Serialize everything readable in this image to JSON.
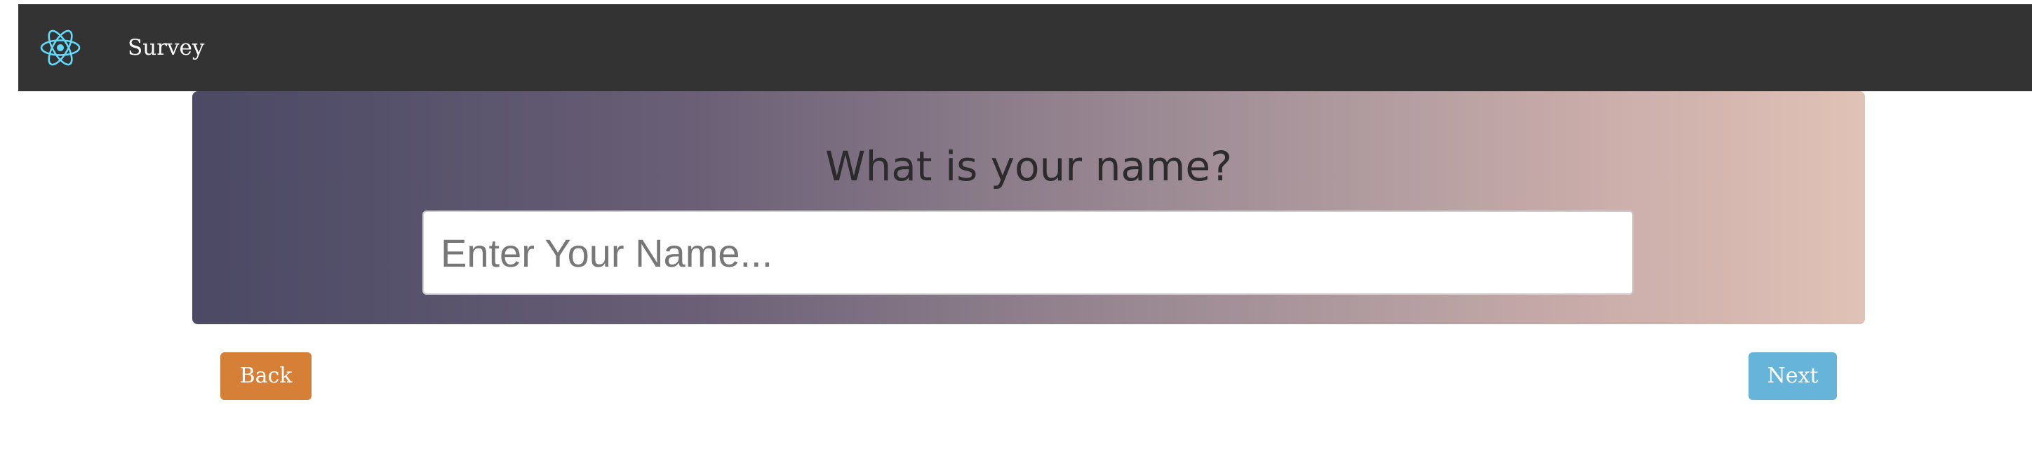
{
  "navbar": {
    "logo_icon": "react-atom-icon",
    "brand": "Survey",
    "background": "#333333"
  },
  "hero": {
    "question": "What is your name?",
    "gradient_start": "#4c4964",
    "gradient_end": "#e0c2b6"
  },
  "name_input": {
    "placeholder": "Enter Your Name...",
    "value": ""
  },
  "buttons": {
    "back_label": "Back",
    "back_color": "#d57f37",
    "next_label": "Next",
    "next_color": "#66b4d9"
  }
}
